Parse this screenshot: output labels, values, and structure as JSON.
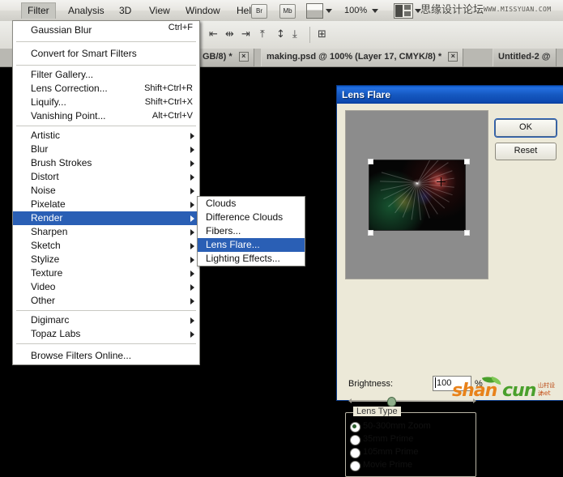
{
  "app": {
    "menubar": {
      "items": [
        {
          "label": "Filter",
          "accel": "F",
          "active": true
        },
        {
          "label": "Analysis",
          "accel": "A",
          "active": false
        },
        {
          "label": "3D",
          "accel": "D",
          "active": false
        },
        {
          "label": "View",
          "accel": "V",
          "active": false
        },
        {
          "label": "Window",
          "accel": "W",
          "active": false
        },
        {
          "label": "Help",
          "accel": "H",
          "active": false
        }
      ],
      "bridge_button": "Br",
      "minibridge_button": "Mb",
      "zoom_level": "100%",
      "brand_text": "思缘设计论坛",
      "site_url": "WWW.MISSYUAN.COM"
    },
    "tabs": [
      {
        "label": "GB/8) *",
        "selected": false,
        "close": "×"
      },
      {
        "label": "making.psd @ 100% (Layer 17, CMYK/8) *",
        "selected": true,
        "close": "×"
      },
      {
        "label": "Untitled-2 @",
        "selected": false,
        "close": ""
      }
    ]
  },
  "filter_menu": {
    "groups": [
      [
        {
          "label": "Gaussian Blur",
          "shortcut": "Ctrl+F",
          "submenu": false,
          "selected": false
        }
      ],
      [
        {
          "label": "Convert for Smart Filters",
          "shortcut": "",
          "submenu": false,
          "selected": false
        }
      ],
      [
        {
          "label": "Filter Gallery...",
          "shortcut": "",
          "submenu": false,
          "selected": false
        },
        {
          "label": "Lens Correction...",
          "shortcut": "Shift+Ctrl+R",
          "submenu": false,
          "selected": false
        },
        {
          "label": "Liquify...",
          "shortcut": "Shift+Ctrl+X",
          "submenu": false,
          "selected": false
        },
        {
          "label": "Vanishing Point...",
          "shortcut": "Alt+Ctrl+V",
          "submenu": false,
          "selected": false
        }
      ],
      [
        {
          "label": "Artistic",
          "shortcut": "",
          "submenu": true,
          "selected": false
        },
        {
          "label": "Blur",
          "shortcut": "",
          "submenu": true,
          "selected": false
        },
        {
          "label": "Brush Strokes",
          "shortcut": "",
          "submenu": true,
          "selected": false
        },
        {
          "label": "Distort",
          "shortcut": "",
          "submenu": true,
          "selected": false
        },
        {
          "label": "Noise",
          "shortcut": "",
          "submenu": true,
          "selected": false
        },
        {
          "label": "Pixelate",
          "shortcut": "",
          "submenu": true,
          "selected": false
        },
        {
          "label": "Render",
          "shortcut": "",
          "submenu": true,
          "selected": true
        },
        {
          "label": "Sharpen",
          "shortcut": "",
          "submenu": true,
          "selected": false
        },
        {
          "label": "Sketch",
          "shortcut": "",
          "submenu": true,
          "selected": false
        },
        {
          "label": "Stylize",
          "shortcut": "",
          "submenu": true,
          "selected": false
        },
        {
          "label": "Texture",
          "shortcut": "",
          "submenu": true,
          "selected": false
        },
        {
          "label": "Video",
          "shortcut": "",
          "submenu": true,
          "selected": false
        },
        {
          "label": "Other",
          "shortcut": "",
          "submenu": true,
          "selected": false
        }
      ],
      [
        {
          "label": "Digimarc",
          "shortcut": "",
          "submenu": true,
          "selected": false
        },
        {
          "label": "Topaz Labs",
          "shortcut": "",
          "submenu": true,
          "selected": false
        }
      ],
      [
        {
          "label": "Browse Filters Online...",
          "shortcut": "",
          "submenu": false,
          "selected": false
        }
      ]
    ]
  },
  "render_submenu": {
    "items": [
      {
        "label": "Clouds",
        "selected": false
      },
      {
        "label": "Difference Clouds",
        "selected": false
      },
      {
        "label": "Fibers...",
        "selected": false
      },
      {
        "label": "Lens Flare...",
        "selected": true
      },
      {
        "label": "Lighting Effects...",
        "selected": false
      }
    ]
  },
  "dialog": {
    "title": "Lens Flare",
    "ok_label": "OK",
    "reset_label": "Reset",
    "brightness_label": "Brightness:",
    "brightness_value": "100",
    "brightness_unit": "%",
    "lens_type_legend": "Lens Type",
    "lens_types": [
      {
        "label": "50-300mm Zoom",
        "selected": true
      },
      {
        "label": "35mm Prime",
        "selected": false
      },
      {
        "label": "105mm Prime",
        "selected": false
      },
      {
        "label": "Movie Prime",
        "selected": false
      }
    ]
  },
  "watermark": {
    "part1": "shan",
    "part2": "cun",
    "domain_top": "山村设计",
    "domain_bottom": ".net"
  },
  "colors": {
    "menu_highlight": "#2a5fb5",
    "dialog_titlebar": "#1558c0",
    "dialog_face": "#ece9d8",
    "canvas": "#000000"
  }
}
